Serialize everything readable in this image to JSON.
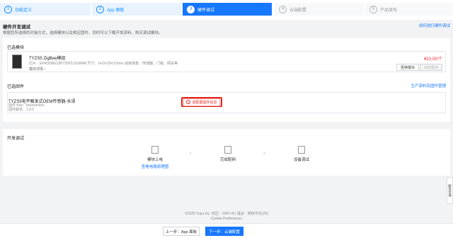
{
  "steps": [
    {
      "num": "1",
      "label": "功能定义",
      "state": "done"
    },
    {
      "num": "2",
      "label": "App 面板",
      "state": "done"
    },
    {
      "num": "3",
      "label": "硬件调试",
      "state": "active"
    },
    {
      "num": "4",
      "label": "云端配置",
      "state": "todo"
    },
    {
      "num": "5",
      "label": "产品发布",
      "state": "todo"
    }
  ],
  "header": {
    "title": "硬件开发调试",
    "desc": "根据您所选择的对接方式，选择模块以及相应固件，同时可以下载开发资料、购买调试模块。",
    "help": "如何进行硬件调试"
  },
  "module": {
    "section_title": "已选模块",
    "name": "TYZS5 ZigBee模组",
    "spec": "芯片：EFR32MG13P732F512GM48  尺寸：14.8×20×3.0mm  适用场景：传感器、门锁、网关等",
    "detail": "模块详情 ›",
    "price": "¥23.00/个",
    "change_btn": "更换模块",
    "buy_btn": "采购模块"
  },
  "firmware": {
    "section_title": "已选固件",
    "link": "生产资料及固件管理",
    "name": "TYZS5电平触发式OEM传感器-水浸",
    "key": "固件 Key：keyxxxxxxx",
    "version": "固件版本：1.0.0",
    "config_btn": "请配置固件信息"
  },
  "dev": {
    "section_title": "开发调试",
    "items": [
      {
        "label": "模块上电",
        "link": "查看电路原理图"
      },
      {
        "label": "完成配网",
        "link": ""
      },
      {
        "label": "设备调试",
        "link": ""
      }
    ]
  },
  "side_tab": "服务咨询",
  "footer": {
    "line1": "©2020 Tuya Inc.  时区：GMT+8  |  语言：简体中文(Zh)",
    "line2": "Cookie Preferences"
  },
  "bottom": {
    "prev": "上一步：App 面板",
    "next": "下一步：云端配置"
  },
  "colors": {
    "primary": "#1677ff",
    "danger": "#e0241b",
    "price": "#f5222d"
  }
}
